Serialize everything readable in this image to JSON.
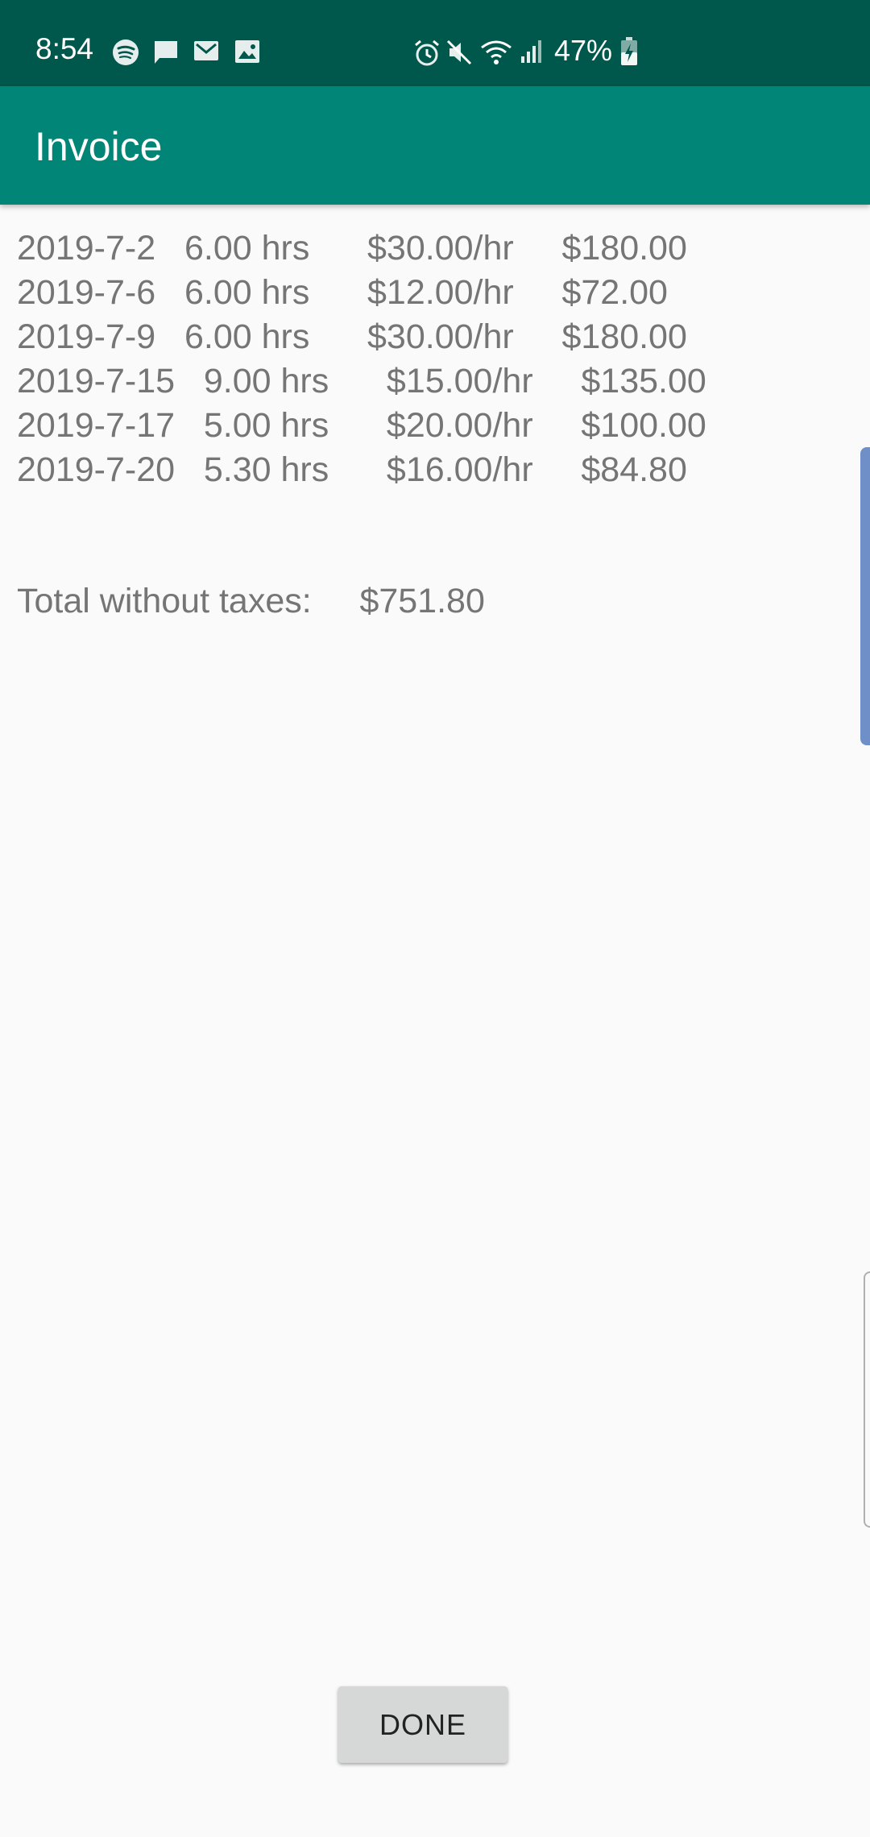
{
  "status_bar": {
    "time": "8:54",
    "battery": "47%",
    "left_icons": [
      "spotify-icon",
      "message-icon",
      "gmail-icon",
      "gallery-icon"
    ],
    "right_icons": [
      "alarm-icon",
      "mute-icon",
      "wifi-icon",
      "signal-icon",
      "battery-charging-icon"
    ]
  },
  "app_bar": {
    "title": "Invoice"
  },
  "invoice": {
    "rows": [
      "2019-7-2   6.00 hrs      $30.00/hr     $180.00",
      "2019-7-6   6.00 hrs      $12.00/hr     $72.00",
      "2019-7-9   6.00 hrs      $30.00/hr     $180.00",
      "2019-7-15   9.00 hrs      $15.00/hr     $135.00",
      "2019-7-17   5.00 hrs      $20.00/hr     $100.00",
      "2019-7-20   5.30 hrs      $16.00/hr     $84.80"
    ],
    "total_label": "Total without taxes:",
    "total_value": "$751.80"
  },
  "actions": {
    "done_label": "DONE"
  },
  "colors": {
    "status_bar": "#00574b",
    "app_bar": "#008577",
    "background": "#fafafa",
    "text": "#757575",
    "button": "#d6d7d7"
  }
}
